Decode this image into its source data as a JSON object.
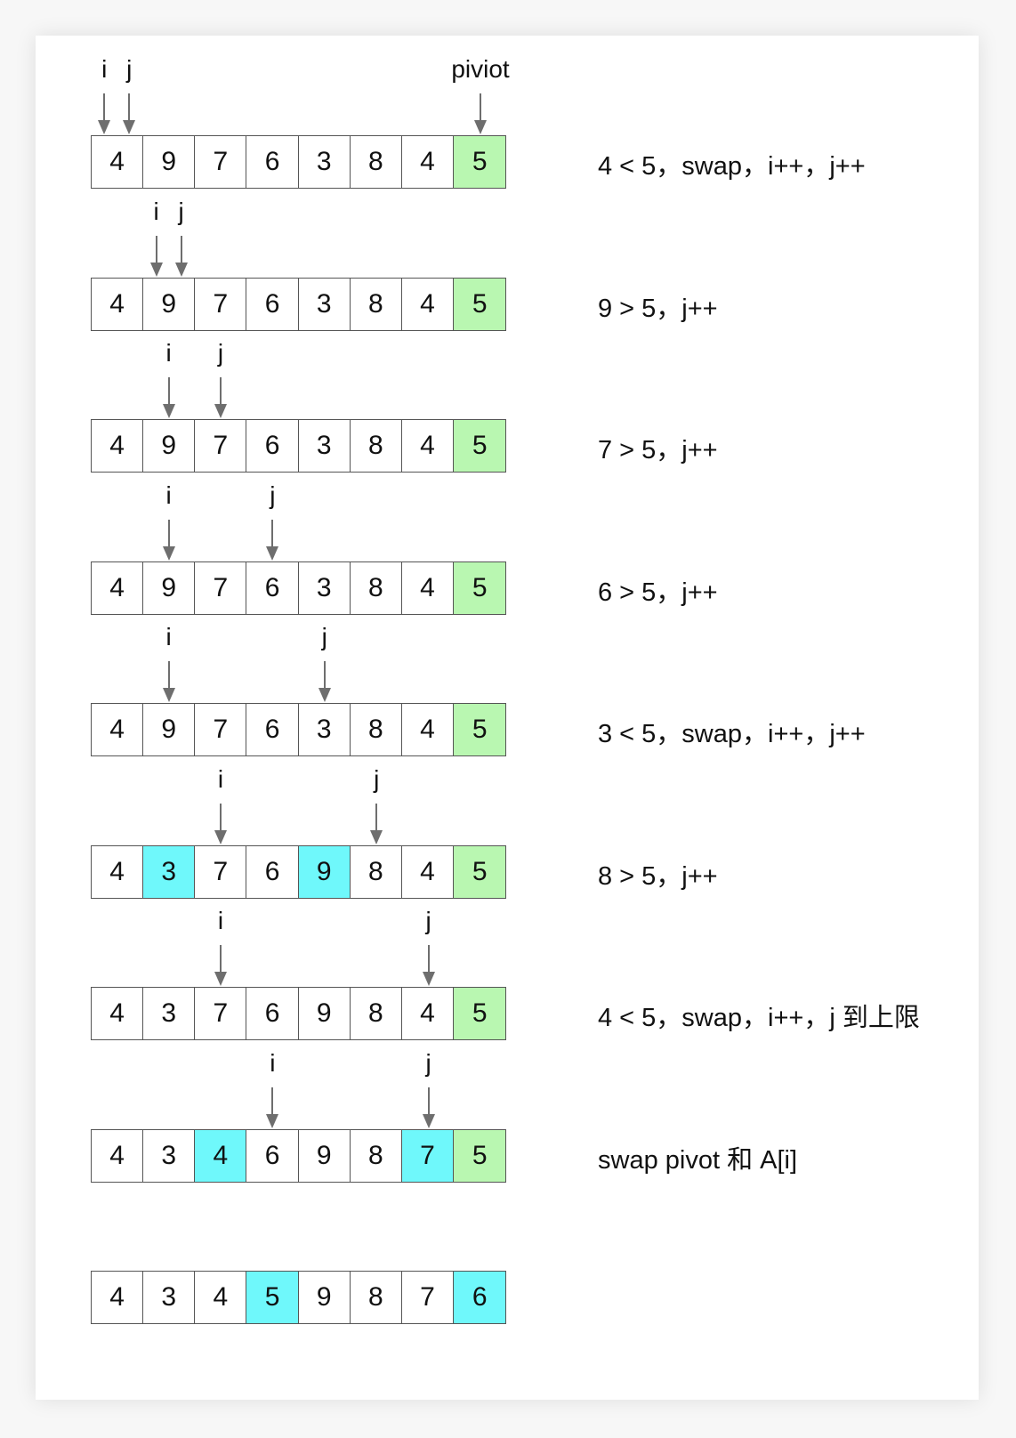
{
  "colors": {
    "pivot": "#b9f7b1",
    "swapped": "#6ff8fb",
    "normal": "#ffffff",
    "arrow": "#6e6e6e"
  },
  "pivot_label": "piviot",
  "pointer_labels": {
    "i": "i",
    "j": "j"
  },
  "steps": [
    {
      "values": [
        "4",
        "9",
        "7",
        "6",
        "3",
        "8",
        "4",
        "5"
      ],
      "highlight": [
        "",
        "",
        "",
        "",
        "",
        "",
        "",
        "pivot"
      ],
      "i": 0,
      "j": 0,
      "pivot_marker": true,
      "note": "4 < 5，swap，i++，j++"
    },
    {
      "values": [
        "4",
        "9",
        "7",
        "6",
        "3",
        "8",
        "4",
        "5"
      ],
      "highlight": [
        "",
        "",
        "",
        "",
        "",
        "",
        "",
        "pivot"
      ],
      "i": 1,
      "j": 1,
      "note": "9 > 5，j++"
    },
    {
      "values": [
        "4",
        "9",
        "7",
        "6",
        "3",
        "8",
        "4",
        "5"
      ],
      "highlight": [
        "",
        "",
        "",
        "",
        "",
        "",
        "",
        "pivot"
      ],
      "i": 1,
      "j": 2,
      "note": "7 > 5，j++"
    },
    {
      "values": [
        "4",
        "9",
        "7",
        "6",
        "3",
        "8",
        "4",
        "5"
      ],
      "highlight": [
        "",
        "",
        "",
        "",
        "",
        "",
        "",
        "pivot"
      ],
      "i": 1,
      "j": 3,
      "note": "6 > 5，j++"
    },
    {
      "values": [
        "4",
        "9",
        "7",
        "6",
        "3",
        "8",
        "4",
        "5"
      ],
      "highlight": [
        "",
        "",
        "",
        "",
        "",
        "",
        "",
        "pivot"
      ],
      "i": 1,
      "j": 4,
      "note": "3 < 5，swap，i++，j++"
    },
    {
      "values": [
        "4",
        "3",
        "7",
        "6",
        "9",
        "8",
        "4",
        "5"
      ],
      "highlight": [
        "",
        "swapped",
        "",
        "",
        "swapped",
        "",
        "",
        "pivot"
      ],
      "i": 2,
      "j": 5,
      "note": "8 > 5，j++"
    },
    {
      "values": [
        "4",
        "3",
        "7",
        "6",
        "9",
        "8",
        "4",
        "5"
      ],
      "highlight": [
        "",
        "",
        "",
        "",
        "",
        "",
        "",
        "pivot"
      ],
      "i": 2,
      "j": 6,
      "note": "4 < 5，swap，i++，j 到上限"
    },
    {
      "values": [
        "4",
        "3",
        "4",
        "6",
        "9",
        "8",
        "7",
        "5"
      ],
      "highlight": [
        "",
        "",
        "swapped",
        "",
        "",
        "",
        "swapped",
        "pivot"
      ],
      "i": 3,
      "j": 6,
      "note": "swap pivot 和 A[i]"
    },
    {
      "values": [
        "4",
        "3",
        "4",
        "5",
        "9",
        "8",
        "7",
        "6"
      ],
      "highlight": [
        "",
        "",
        "",
        "swapped",
        "",
        "",
        "",
        "swapped"
      ],
      "note": ""
    }
  ]
}
